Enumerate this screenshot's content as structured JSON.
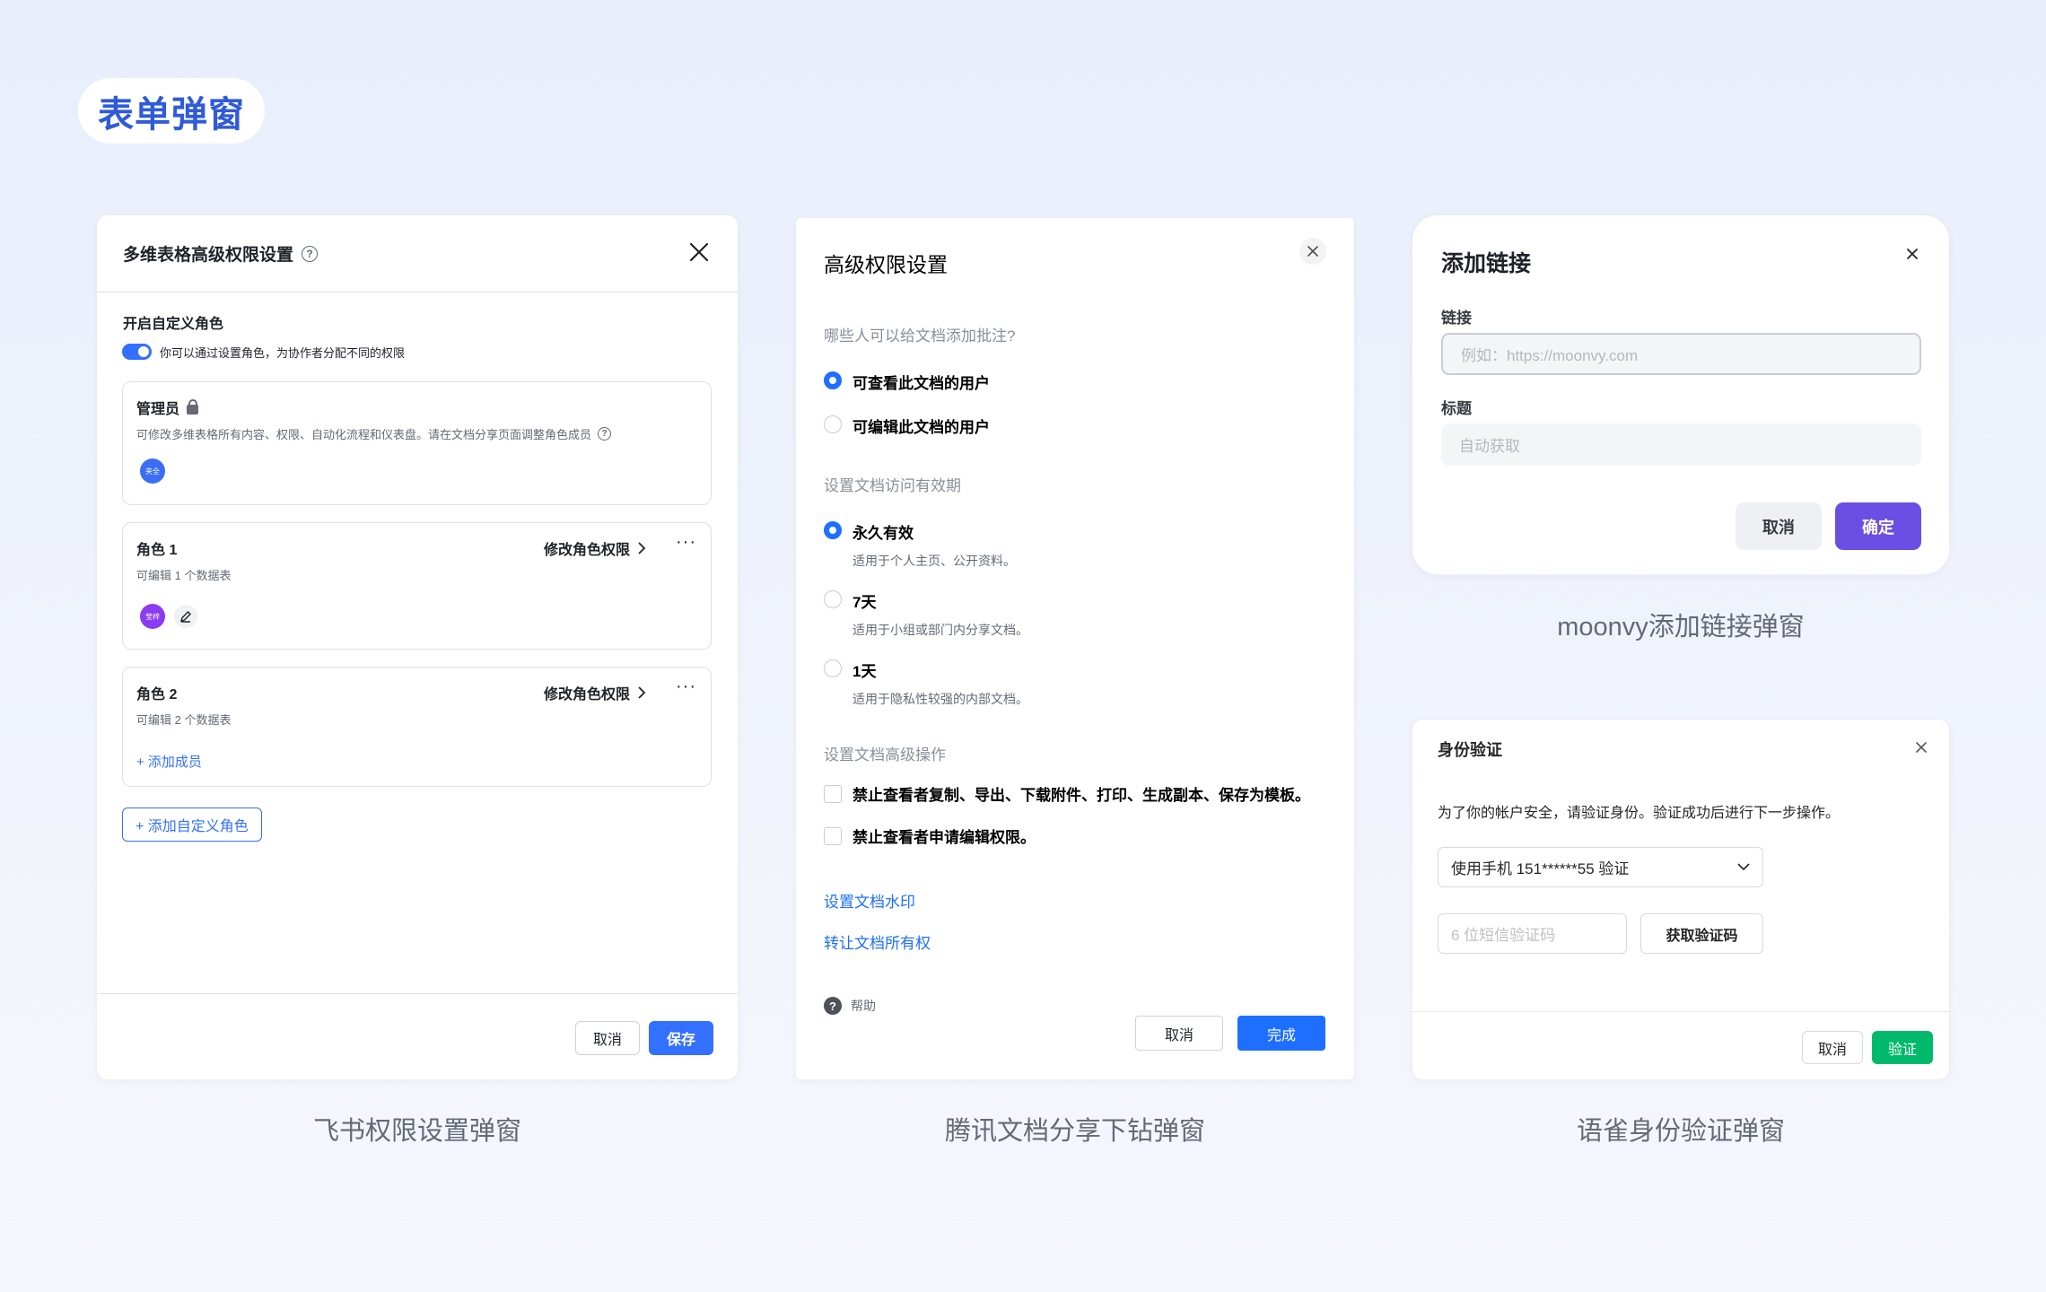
{
  "page": {
    "section_tag": "表单弹窗"
  },
  "feishu": {
    "caption": "飞书权限设置弹窗",
    "title": "多维表格高级权限设置",
    "custom_role_title": "开启自定义角色",
    "custom_role_desc": "你可以通过设置角色，为协作者分配不同的权限",
    "toggle_on": true,
    "admin": {
      "title": "管理员",
      "desc": "可修改多维表格所有内容、权限、自动化流程和仪表盘。请在文档分享页面调整角色成员",
      "avatar_text": "夹全",
      "avatar_color": "#3b6ef5"
    },
    "roles": [
      {
        "title": "角色 1",
        "desc": "可编辑 1 个数据表",
        "action": "修改角色权限",
        "avatar_text": "莹梓",
        "avatar_color": "#8b3bf2"
      },
      {
        "title": "角色 2",
        "desc": "可编辑 2 个数据表",
        "action": "修改角色权限",
        "add_member": "+ 添加成员"
      }
    ],
    "add_role": "+ 添加自定义角色",
    "cancel": "取消",
    "save": "保存",
    "accent": "#3370ff"
  },
  "tencent": {
    "caption": "腾讯文档分享下钻弹窗",
    "title": "高级权限设置",
    "q1": "哪些人可以给文档添加批注?",
    "q1_options": [
      {
        "label": "可查看此文档的用户",
        "checked": true
      },
      {
        "label": "可编辑此文档的用户",
        "checked": false
      }
    ],
    "q2": "设置文档访问有效期",
    "q2_options": [
      {
        "label": "永久有效",
        "sub": "适用于个人主页、公开资料。",
        "checked": true
      },
      {
        "label": "7天",
        "sub": "适用于小组或部门内分享文档。",
        "checked": false
      },
      {
        "label": "1天",
        "sub": "适用于隐私性较强的内部文档。",
        "checked": false
      }
    ],
    "q3": "设置文档高级操作",
    "q3_options": [
      {
        "label": "禁止查看者复制、导出、下载附件、打印、生成副本、保存为模板。",
        "checked": false
      },
      {
        "label": "禁止查看者申请编辑权限。",
        "checked": false
      }
    ],
    "links": [
      "设置文档水印",
      "转让文档所有权"
    ],
    "help": "帮助",
    "cancel": "取消",
    "done": "完成",
    "accent": "#1e6fff"
  },
  "moonvy": {
    "caption": "moonvy添加链接弹窗",
    "title": "添加链接",
    "link_label": "链接",
    "link_placeholder": "例如：https://moonvy.com",
    "title_label": "标题",
    "title_placeholder": "自动获取",
    "cancel": "取消",
    "confirm": "确定",
    "accent": "#6a4fe4"
  },
  "yuque": {
    "caption": "语雀身份验证弹窗",
    "title": "身份验证",
    "desc": "为了你的帐户安全，请验证身份。验证成功后进行下一步操作。",
    "method": "使用手机 151******55 验证",
    "code_placeholder": "6 位短信验证码",
    "get_code": "获取验证码",
    "cancel": "取消",
    "verify": "验证",
    "accent": "#00b96b"
  }
}
